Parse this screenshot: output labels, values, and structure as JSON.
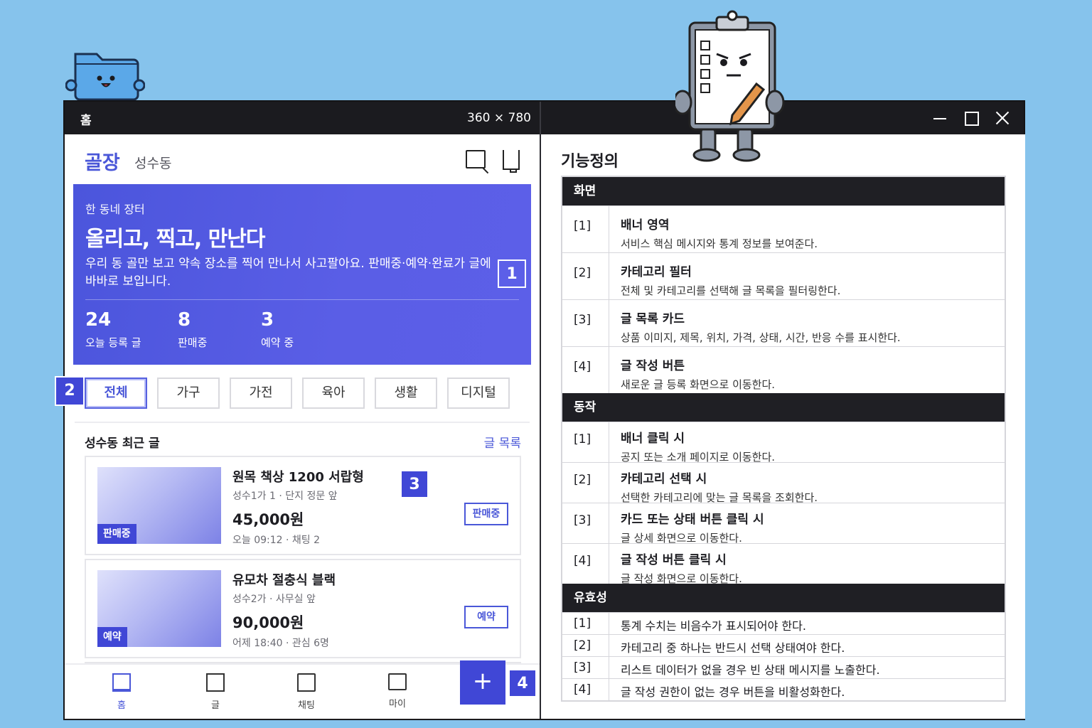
{
  "window": {
    "tab_title": "홈",
    "viewport_size": "360 × 780"
  },
  "app": {
    "logo": "골장",
    "location": "성수동",
    "banner": {
      "kicker": "한 동네 장터",
      "headline": "올리고, 찍고, 만난다",
      "description": "우리 동 골만 보고 약속 장소를 찍어 만나서 사고팔아요. 판매중·예약·완료가 글에 바바로 보입니다.",
      "stats": [
        {
          "value": "24",
          "label": "오늘 등록 글"
        },
        {
          "value": "8",
          "label": "판매중"
        },
        {
          "value": "3",
          "label": "예약 중"
        }
      ]
    },
    "categories": [
      "전체",
      "가구",
      "가전",
      "육아",
      "생활",
      "디지털"
    ],
    "selected_category": "전체",
    "list_section": {
      "title": "성수동 최근 글",
      "link": "글 목록"
    },
    "posts": [
      {
        "title": "원목 책상 1200 서랍형",
        "place": "성수1가 1 · 단지 정문 앞",
        "price": "45,000원",
        "meta": "오늘 09:12 · 채팅 2",
        "thumb_tag": "판매중",
        "status": "판매중"
      },
      {
        "title": "유모차 절충식 블랙",
        "place": "성수2가 · 사무실 앞",
        "price": "90,000원",
        "meta": "어제 18:40 · 관심 6명",
        "thumb_tag": "예약",
        "status": "예약"
      }
    ],
    "fab_label": "+",
    "tabs": [
      "홈",
      "글",
      "채팅",
      "마이"
    ],
    "markers": [
      "1",
      "2",
      "3",
      "4"
    ]
  },
  "spec": {
    "title": "기능정의",
    "sections": [
      {
        "heading": "화면",
        "rows": [
          {
            "idx": "[1]",
            "name": "배너 영역",
            "detail": "서비스 핵심 메시지와 통계 정보를 보여준다."
          },
          {
            "idx": "[2]",
            "name": "카테고리 필터",
            "detail": "전체 및 카테고리를 선택해 글 목록을 필터링한다."
          },
          {
            "idx": "[3]",
            "name": "글 목록 카드",
            "detail": "상품 이미지, 제목, 위치, 가격, 상태, 시간, 반응 수를 표시한다."
          },
          {
            "idx": "[4]",
            "name": "글 작성 버튼",
            "detail": "새로운 글 등록 화면으로 이동한다."
          }
        ]
      },
      {
        "heading": "동작",
        "rows": [
          {
            "idx": "[1]",
            "name": "배너 클릭 시",
            "detail": "공지 또는 소개 페이지로 이동한다."
          },
          {
            "idx": "[2]",
            "name": "카테고리 선택 시",
            "detail": "선택한 카테고리에 맞는 글 목록을 조회한다."
          },
          {
            "idx": "[3]",
            "name": "카드 또는 상태 버튼 클릭 시",
            "detail": "글 상세 화면으로 이동한다."
          },
          {
            "idx": "[4]",
            "name": "글 작성 버튼 클릭 시",
            "detail": "글 작성 화면으로 이동한다."
          }
        ]
      },
      {
        "heading": "유효성",
        "rows": [
          {
            "idx": "[1]",
            "text": "통계 수치는 비음수가 표시되어야 한다."
          },
          {
            "idx": "[2]",
            "text": "카테고리 중 하나는 반드시 선택 상태여야 한다."
          },
          {
            "idx": "[3]",
            "text": "리스트 데이터가 없을 경우 빈 상태 메시지를 노출한다."
          },
          {
            "idx": "[4]",
            "text": "글 작성 권한이 없는 경우 버튼을 비활성화한다."
          }
        ]
      }
    ]
  },
  "colors": {
    "background": "#86c3ec",
    "accent": "#4a57d8",
    "banner": "#5a5ee6",
    "titlebar": "#1b1b1f"
  },
  "icons": [
    "search-icon",
    "bell-icon",
    "home-icon",
    "list-icon",
    "chat-icon",
    "bag-icon",
    "minimize-icon",
    "maximize-icon",
    "close-icon"
  ]
}
